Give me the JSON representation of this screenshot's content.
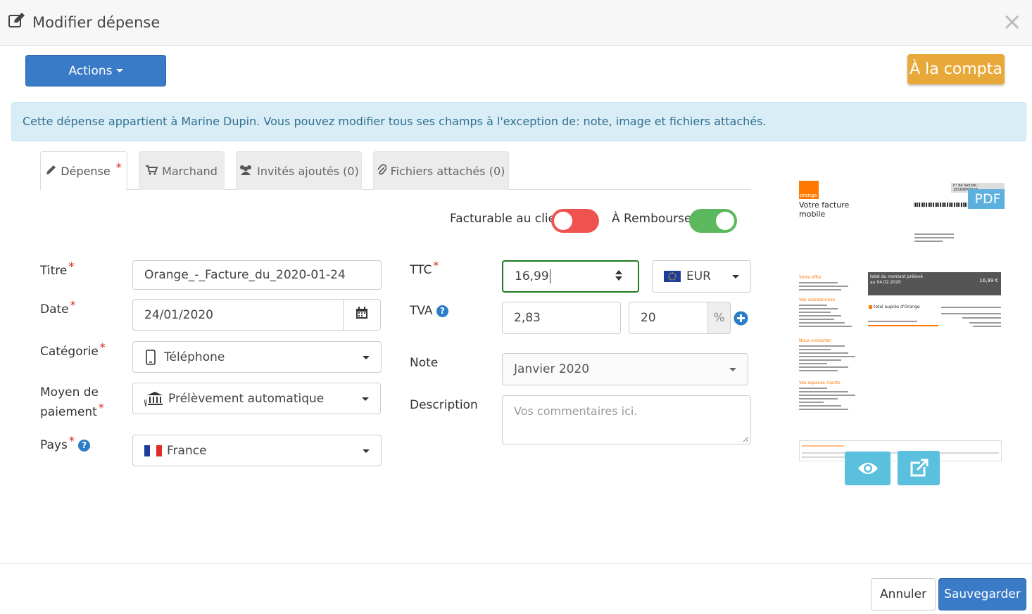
{
  "header": {
    "title": "Modifier dépense",
    "close_label": "×"
  },
  "toolbar": {
    "actions_label": "Actions",
    "compta_label": "À la compta"
  },
  "alert": {
    "text": "Cette dépense appartient à Marine Dupin. Vous pouvez modifier tous ses champs à l'exception de: note, image et fichiers attachés."
  },
  "tabs": [
    {
      "label": "Dépense",
      "icon": "pencil-icon",
      "required": "*",
      "active": true
    },
    {
      "label": "Marchand",
      "icon": "cart-icon"
    },
    {
      "label": "Invités ajoutés (0)",
      "icon": "users-icon"
    },
    {
      "label": "Fichiers attachés (0)",
      "icon": "paperclip-icon"
    }
  ],
  "toggles": {
    "facturable": {
      "label": "Facturable au client",
      "on": false
    },
    "rembourser": {
      "label": "À Rembourser",
      "on": true
    }
  },
  "form": {
    "required_mark": "*",
    "titre": {
      "label": "Titre",
      "value": "Orange_-_Facture_du_2020-01-24"
    },
    "date": {
      "label": "Date",
      "value": "24/01/2020"
    },
    "categorie": {
      "label": "Catégorie",
      "value": "Téléphone"
    },
    "moyen": {
      "label_line1": "Moyen de",
      "label_line2": "paiement",
      "value": "Prélèvement automatique"
    },
    "pays": {
      "label": "Pays",
      "value": "France"
    },
    "ttc": {
      "label": "TTC",
      "value": "16,99",
      "currency": "EUR"
    },
    "tva": {
      "label": "TVA",
      "value": "2,83",
      "rate": "20",
      "rate_unit": "%"
    },
    "note": {
      "label": "Note",
      "value": "Janvier 2020"
    },
    "description": {
      "label": "Description",
      "placeholder": "Vos commentaires ici."
    }
  },
  "preview": {
    "badge": "PDF",
    "logo_text": "orange",
    "doc_title_line1": "Votre facture",
    "doc_title_line2": "mobile",
    "invoice_no": "n° de facture : 18169847323",
    "amount_label": "total du montant prélevé",
    "amount_date": "au 04.02.2020",
    "amount": "16,99 €",
    "section_offre": "Votre offre",
    "section_coord": "Vos coordonnées",
    "section_contact": "Nous contacter",
    "section_espaces": "Vos espaces clients",
    "total_orange": "total auprès d'Orange"
  },
  "footer": {
    "cancel_label": "Annuler",
    "save_label": "Sauvegarder"
  },
  "colors": {
    "primary": "#3a7bc8",
    "warning": "#e8a93a",
    "toggle_off": "#ef5350",
    "toggle_on": "#5cb85c",
    "info_bg": "#d9edf7",
    "preview_btn": "#5bc0de"
  }
}
